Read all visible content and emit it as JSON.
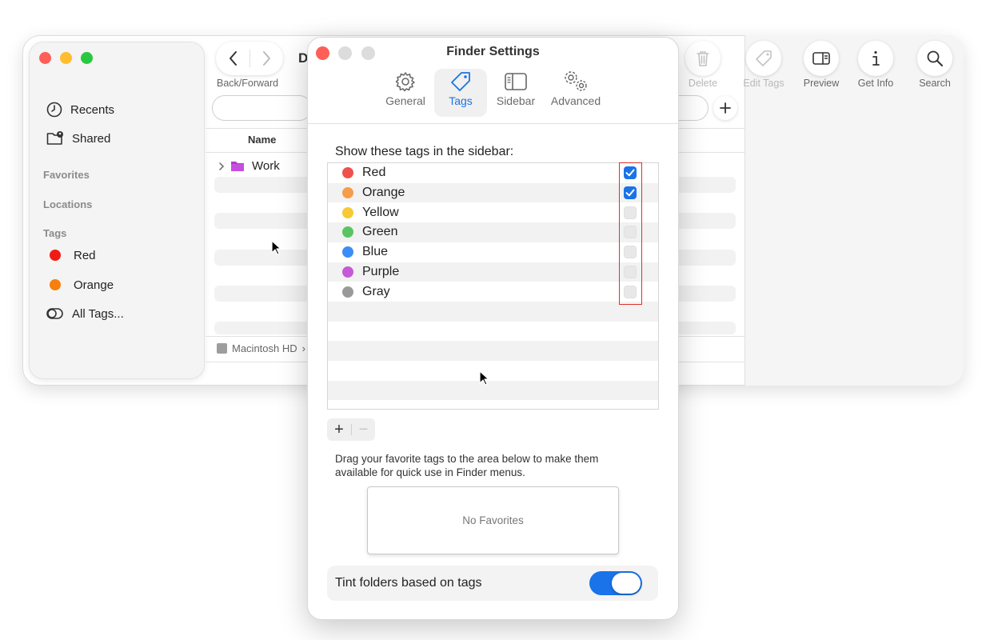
{
  "finder": {
    "nav_label": "Back/Forward",
    "title_partial": "D",
    "sidebar": {
      "recents": "Recents",
      "shared": "Shared",
      "favorites": "Favorites",
      "locations": "Locations",
      "tags_header": "Tags",
      "tags": [
        {
          "label": "Red",
          "color": "#f21b14"
        },
        {
          "label": "Orange",
          "color": "#f77f0e"
        }
      ],
      "all_tags": "All Tags..."
    },
    "toolbar": {
      "delete": "Delete",
      "edit_tags": "Edit Tags",
      "preview": "Preview",
      "get_info": "Get Info",
      "search": "Search"
    },
    "list": {
      "column_name": "Name",
      "folder_name": "Work",
      "path": "Macintosh HD",
      "path_sep": "›"
    }
  },
  "settings": {
    "title": "Finder Settings",
    "tabs": [
      {
        "label": "General",
        "icon": "gear-icon"
      },
      {
        "label": "Tags",
        "icon": "tag-icon",
        "active": true
      },
      {
        "label": "Sidebar",
        "icon": "sidebar-icon"
      },
      {
        "label": "Advanced",
        "icon": "gears-icon"
      }
    ],
    "sidebar_heading": "Show these tags in the sidebar:",
    "tags": [
      {
        "name": "Red",
        "color": "#f0504d",
        "checked": true
      },
      {
        "name": "Orange",
        "color": "#f59d49",
        "checked": true
      },
      {
        "name": "Yellow",
        "color": "#f7c934",
        "checked": false
      },
      {
        "name": "Green",
        "color": "#5ac462",
        "checked": false
      },
      {
        "name": "Blue",
        "color": "#3a8ef6",
        "checked": false
      },
      {
        "name": "Purple",
        "color": "#c55ad7",
        "checked": false
      },
      {
        "name": "Gray",
        "color": "#9a9a9a",
        "checked": false
      }
    ],
    "add_symbol": "+",
    "remove_symbol": "−",
    "favorites_help": "Drag your favorite tags to the area below to make them available for quick use in Finder menus.",
    "no_favorites": "No Favorites",
    "tint_label": "Tint folders based on tags",
    "tint_on": true
  }
}
